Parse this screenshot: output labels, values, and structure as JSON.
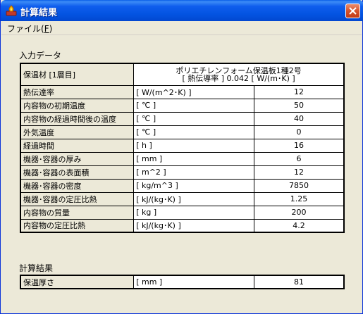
{
  "window": {
    "title": "計算結果"
  },
  "menu": {
    "file_label": "ファイル(",
    "file_mnemonic": "F",
    "file_close": ")"
  },
  "input_section": {
    "heading": "入力データ",
    "material_label": "保温材 [1層目]",
    "material_name": "ポリエチレンフォーム保温板1種2号",
    "material_conductivity": "[ 熱伝導率 ] 0.042 [ W/(m･K) ]",
    "rows": [
      {
        "label": "熱伝達率",
        "unit": "[ W/(m^2･K) ]",
        "value": "12"
      },
      {
        "label": "内容物の初期温度",
        "unit": "[ ℃ ]",
        "value": "50"
      },
      {
        "label": "内容物の経過時間後の温度",
        "unit": "[ ℃ ]",
        "value": "40"
      },
      {
        "label": "外気温度",
        "unit": "[ ℃ ]",
        "value": "0"
      },
      {
        "label": "経過時間",
        "unit": "[ h ]",
        "value": "16"
      },
      {
        "label": "機器･容器の厚み",
        "unit": "[ mm ]",
        "value": "6"
      },
      {
        "label": "機器･容器の表面積",
        "unit": "[ m^2 ]",
        "value": "12"
      },
      {
        "label": "機器･容器の密度",
        "unit": "[ kg/m^3 ]",
        "value": "7850"
      },
      {
        "label": "機器･容器の定圧比熱",
        "unit": "[ kJ/(kg･K) ]",
        "value": "1.25"
      },
      {
        "label": "内容物の質量",
        "unit": "[ kg ]",
        "value": "200"
      },
      {
        "label": "内容物の定圧比熱",
        "unit": "[ kJ/(kg･K) ]",
        "value": "4.2"
      }
    ]
  },
  "result_section": {
    "heading": "計算結果",
    "rows": [
      {
        "label": "保温厚さ",
        "unit": "[ mm ]",
        "value": "81"
      }
    ]
  }
}
